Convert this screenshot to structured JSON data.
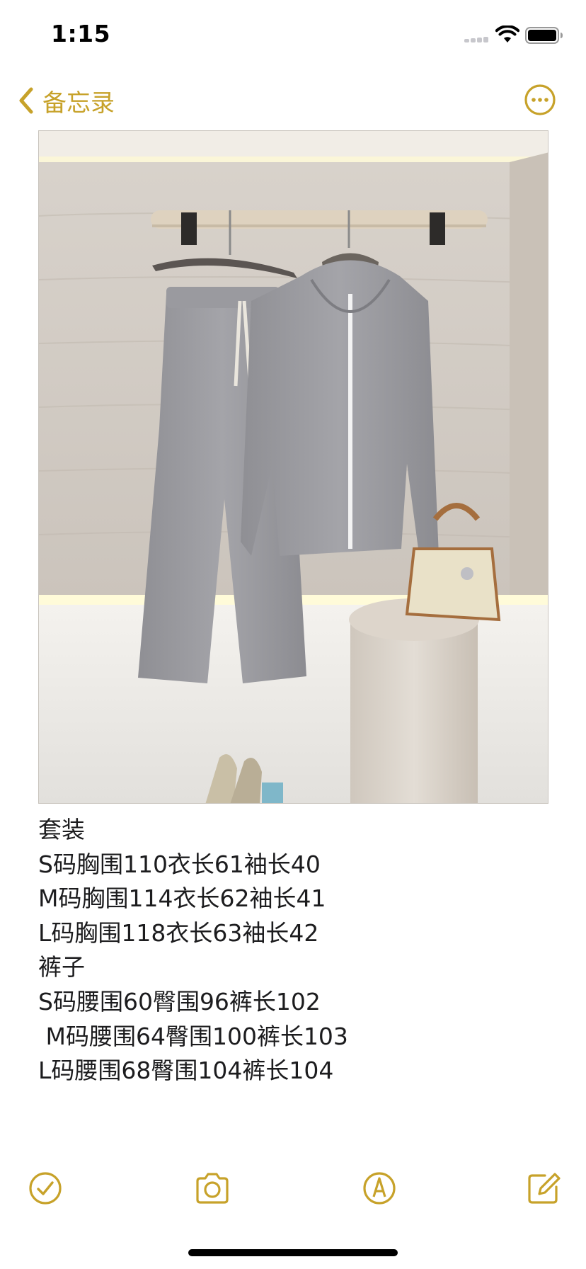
{
  "status_bar": {
    "time": "1:15",
    "signal_icon": "cellular-signal-icon",
    "wifi_icon": "wifi-icon",
    "battery_icon": "battery-icon",
    "battery_level": 0.95
  },
  "nav": {
    "back_label": "备忘录",
    "back_icon": "chevron-left-icon",
    "more_icon": "ellipsis-circle-icon",
    "accent_color": "#c7a22a"
  },
  "photo": {
    "subject": "photo-of-grey-hoodie-and-wide-leg-pants-set-on-hanger"
  },
  "note": {
    "lines": [
      "套装",
      "S码胸围110衣长61袖长40",
      "M码胸围114衣长62袖长41",
      "L码胸围118衣长63袖长42",
      "裤子",
      "S码腰围60臀围96裤长102",
      " M码腰围64臀围100裤长103",
      "L码腰围68臀围104裤长104"
    ]
  },
  "toolbar": {
    "checklist_icon": "checklist-icon",
    "camera_icon": "camera-icon",
    "markup_icon": "markup-pen-icon",
    "compose_icon": "compose-icon"
  }
}
